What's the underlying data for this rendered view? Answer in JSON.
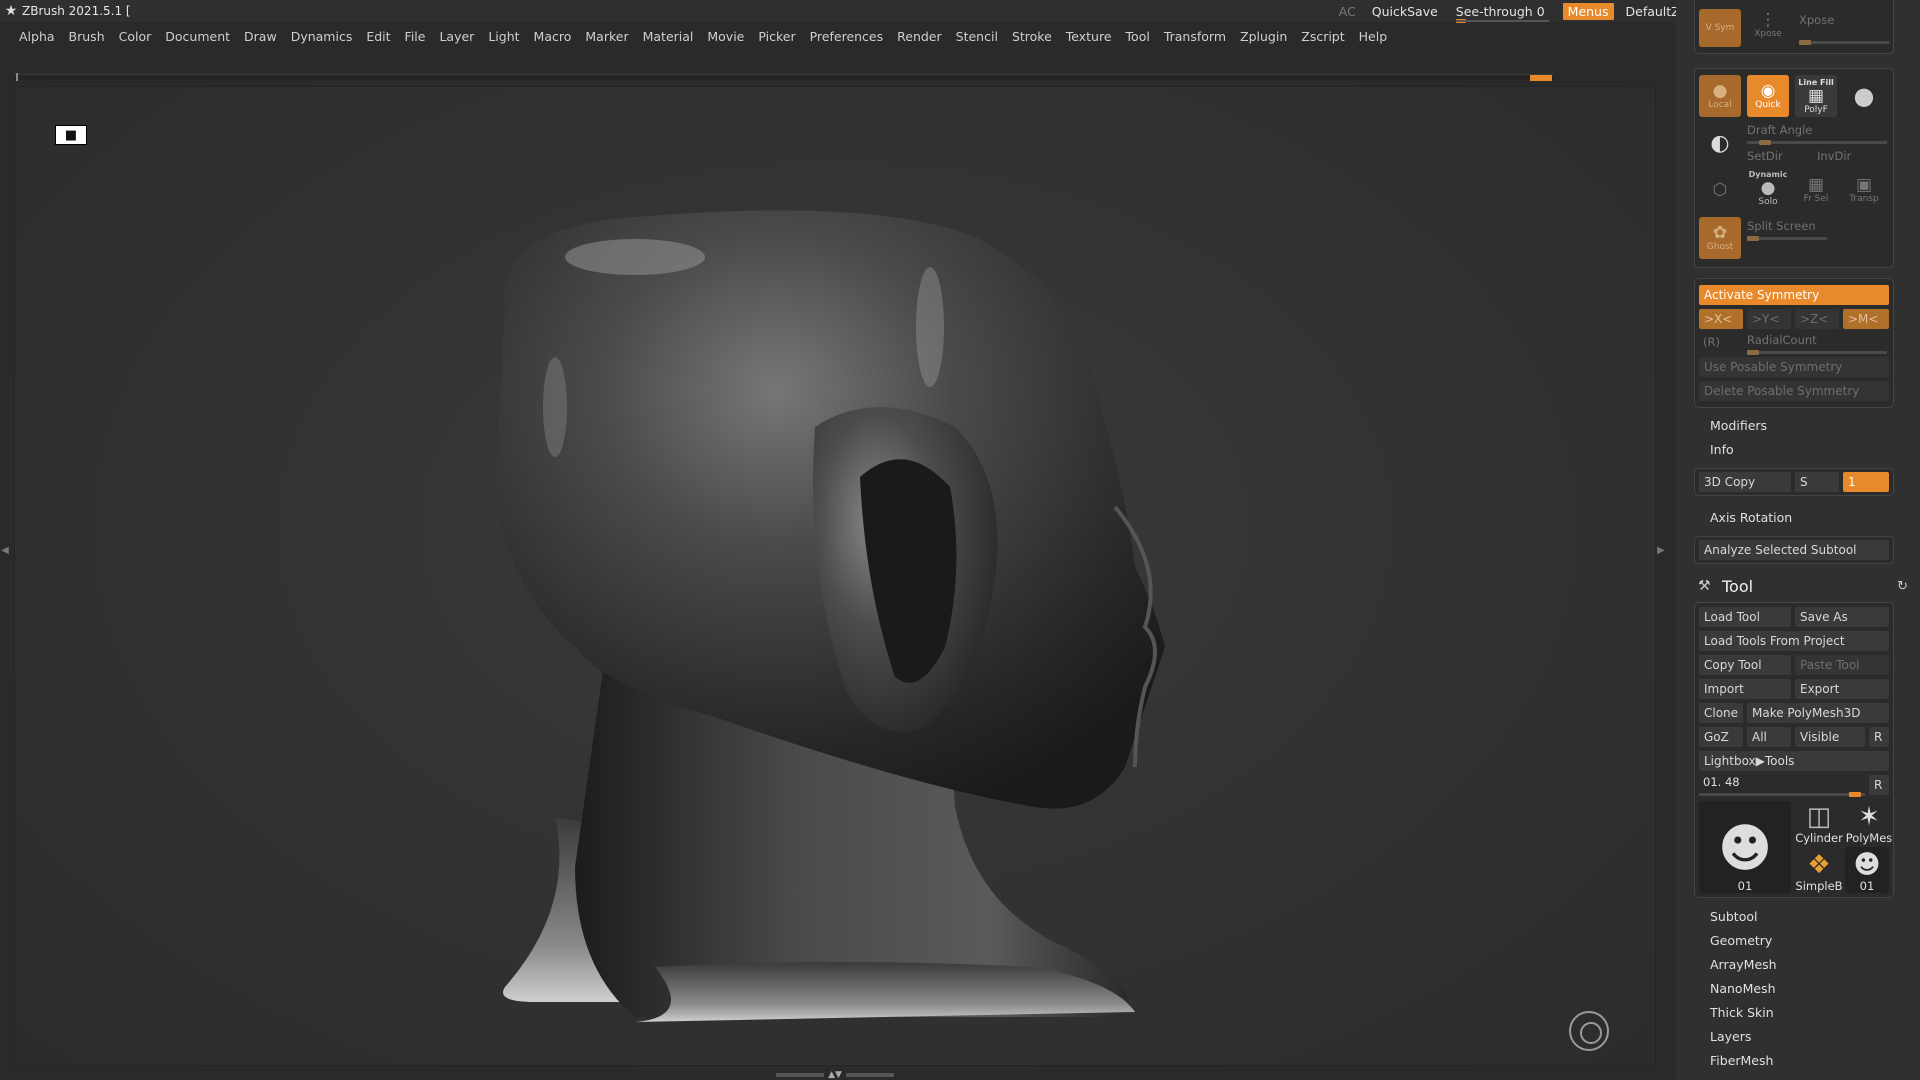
{
  "titlebar": {
    "title": "ZBrush 2021.5.1 [",
    "ac": "AC",
    "quicksave": "QuickSave",
    "see_through": "See-through  0",
    "menus": "Menus",
    "script": "DefaultZScript"
  },
  "menubar": [
    "Alpha",
    "Brush",
    "Color",
    "Document",
    "Draw",
    "Dynamics",
    "Edit",
    "File",
    "Layer",
    "Light",
    "Macro",
    "Marker",
    "Material",
    "Movie",
    "Picker",
    "Preferences",
    "Render",
    "Stencil",
    "Stroke",
    "Texture",
    "Tool",
    "Transform",
    "Zplugin",
    "Zscript",
    "Help"
  ],
  "panel": {
    "top": {
      "vsym": "V Sym",
      "xpose": "Xpose",
      "xpose_label": "Xpose"
    },
    "display": {
      "local": "Local",
      "quick": "Quick",
      "linefill": "Line Fill",
      "polyf": "PolyF",
      "draft_angle": "Draft Angle",
      "setdir": "SetDir",
      "invdir": "InvDir",
      "dynamic": "Dynamic",
      "solo": "Solo",
      "frsel": "Fr Sel",
      "transp": "Transp",
      "ghost": "Ghost",
      "split_screen": "Split Screen"
    },
    "symmetry": {
      "activate": "Activate Symmetry",
      "x": ">X<",
      "y": ">Y<",
      "z": ">Z<",
      "m": ">M<",
      "r": "(R)",
      "radial": "RadialCount",
      "use_posable": "Use Posable Symmetry",
      "delete_posable": "Delete Posable Symmetry"
    },
    "modifiers": "Modifiers",
    "info": "Info",
    "copy3d": {
      "label": "3D Copy",
      "s": "S",
      "value": "1"
    },
    "axis_rotation": "Axis Rotation",
    "analyze": "Analyze Selected Subtool",
    "tool": {
      "title": "Tool",
      "load": "Load Tool",
      "save_as": "Save As",
      "load_from_project": "Load Tools From Project",
      "copy": "Copy Tool",
      "paste": "Paste Tool",
      "import": "Import",
      "export": "Export",
      "clone": "Clone",
      "make_polymesh": "Make PolyMesh3D",
      "goz": "GoZ",
      "all": "All",
      "visible": "Visible",
      "r": "R",
      "lightbox": "Lightbox▶Tools",
      "current": "01. 48",
      "current_r": "R",
      "thumbs": {
        "main": "01",
        "cylinder": "Cylinder",
        "polymesh": "PolyMes",
        "simpleb": "SimpleB",
        "small": "01"
      }
    },
    "subpalettes": [
      "Subtool",
      "Geometry",
      "ArrayMesh",
      "NanoMesh",
      "Thick Skin",
      "Layers",
      "FiberMesh"
    ]
  },
  "colors": {
    "accent": "#e8892b",
    "panel": "#303030",
    "viewport": "#333333"
  }
}
